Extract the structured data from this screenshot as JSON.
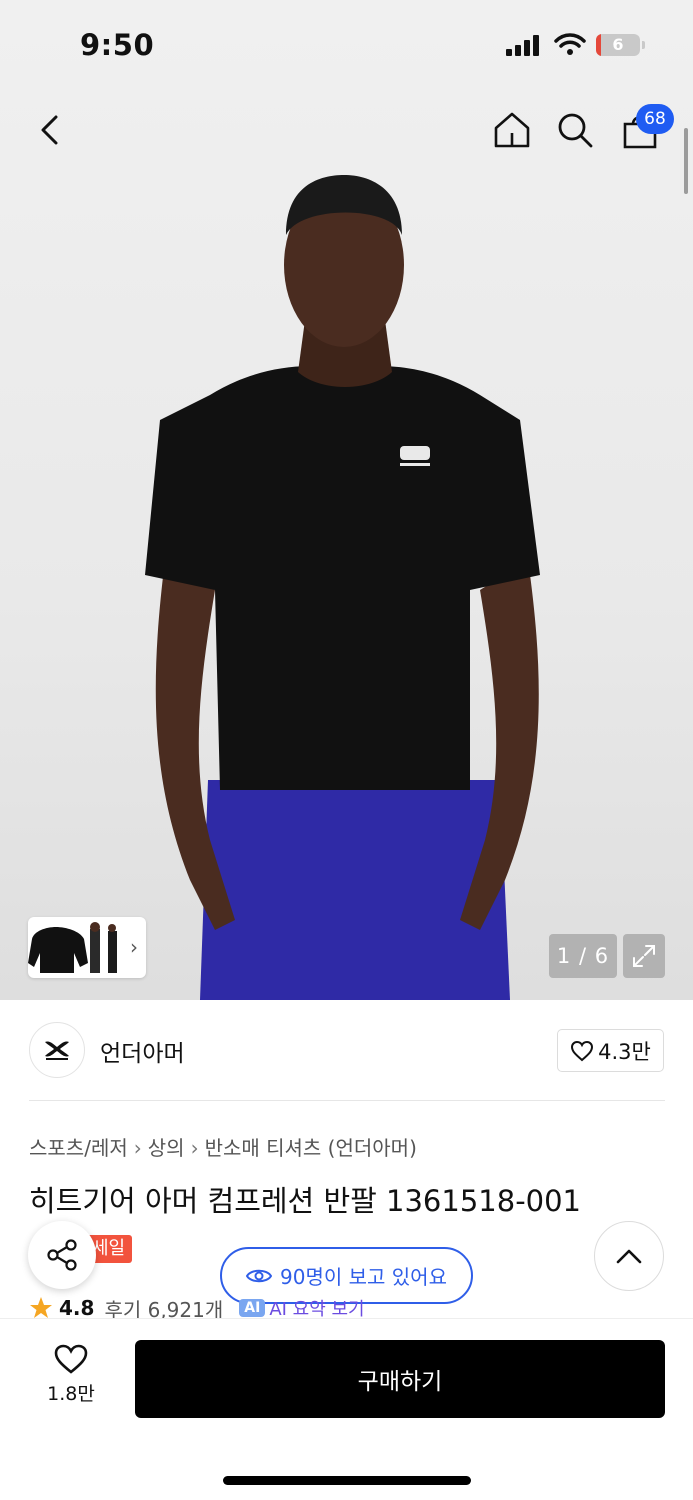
{
  "status_bar": {
    "time": "9:50",
    "battery": "6"
  },
  "header": {
    "cart_count": "68"
  },
  "gallery": {
    "counter": "1 / 6"
  },
  "brand": {
    "name": "언더아머",
    "likes": "4.3만"
  },
  "breadcrumb": [
    "스포츠/레저",
    "상의",
    "반소매 티셔츠 (언더아머)"
  ],
  "product": {
    "title": "히트기어 아머 컴프레션 반팔 1361518-001",
    "sale_badge": "세일"
  },
  "viewers": "90명이 보고 있어요",
  "rating": {
    "score": "4.8",
    "reviews": "후기 6,921개",
    "ai_label": "AI",
    "ai_summary": "AI 요약 보기"
  },
  "bottom": {
    "wish_count": "1.8만",
    "buy_label": "구매하기"
  },
  "colors": {
    "accent_blue": "#1f5cf2",
    "sale_red": "#f2533d",
    "buy_black": "#000000"
  }
}
